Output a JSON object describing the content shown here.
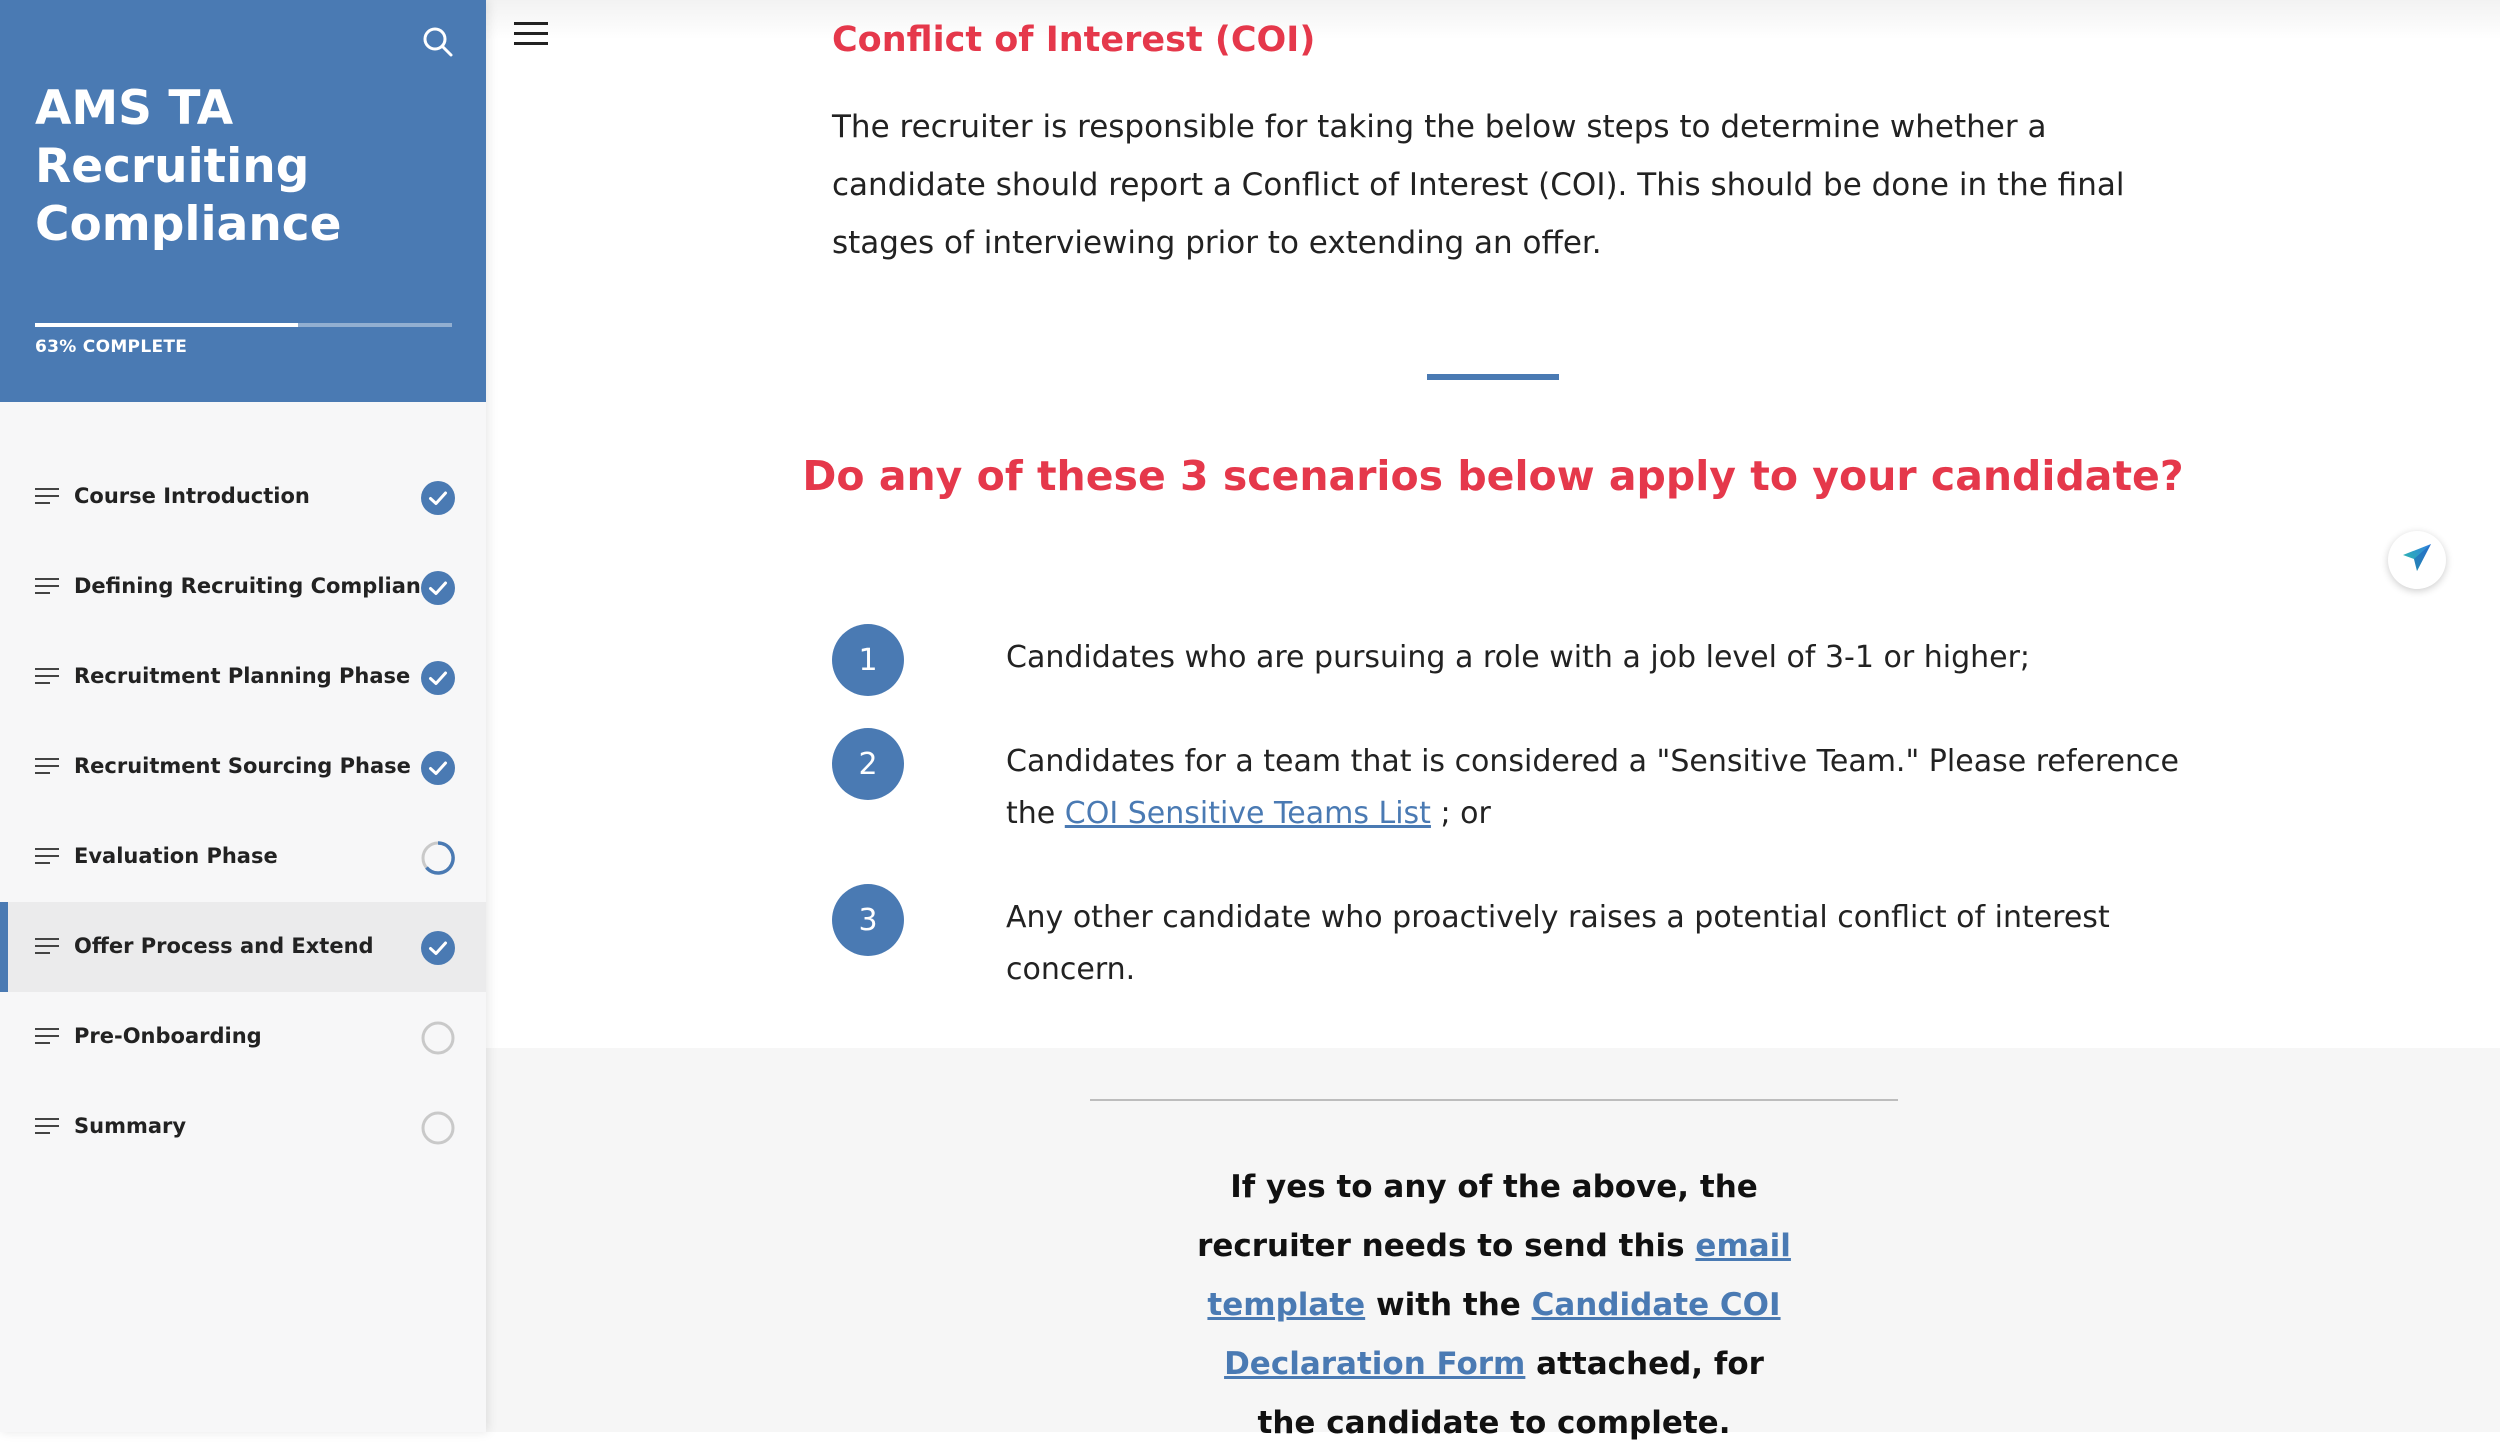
{
  "sidebar": {
    "course_title": "AMS TA Recruiting Compliance",
    "progress": {
      "percent": 63,
      "label": "63% COMPLETE"
    },
    "lessons": [
      {
        "label": "Course Introduction",
        "status": "complete"
      },
      {
        "label": "Defining Recruiting Compliance",
        "status": "complete"
      },
      {
        "label": "Recruitment Planning Phase",
        "status": "complete"
      },
      {
        "label": "Recruitment Sourcing Phase",
        "status": "complete"
      },
      {
        "label": "Evaluation Phase",
        "status": "in-progress"
      },
      {
        "label": "Offer Process and Extend",
        "status": "complete",
        "active": true
      },
      {
        "label": "Pre-Onboarding",
        "status": "not-started"
      },
      {
        "label": "Summary",
        "status": "not-started"
      }
    ]
  },
  "main": {
    "heading": "Conflict of Interest (COI)",
    "intro": "The recruiter is responsible for taking the below steps to determine whether a candidate should report a Conflict of Interest (COI). This should be done in the final stages of interviewing prior to extending an offer.",
    "question": "Do any of these 3 scenarios below apply to your candidate?",
    "scenarios": [
      {
        "number": "1",
        "text": "Candidates who are pursuing a role with a job level of 3-1 or higher;"
      },
      {
        "number": "2",
        "text_before": "Candidates for a team that is considered a \"Sensitive Team.\" Please reference the ",
        "link": "COI Sensitive Teams List",
        "text_after": " ; or"
      },
      {
        "number": "3",
        "text": "Any other candidate who proactively raises a potential conflict of interest concern."
      }
    ],
    "callout": {
      "part1": "If yes to any of the above, the recruiter needs to send this ",
      "link1": "email template",
      "part2": " with the ",
      "link2": "Candidate COI Declaration Form",
      "part3": " attached, for the candidate to complete."
    }
  },
  "colors": {
    "brand_blue": "#4a7ab3",
    "accent_red": "#e5384b"
  },
  "icons": {
    "search": "search-icon",
    "menu": "hamburger-menu-icon",
    "lesson": "lesson-lines-icon",
    "complete": "check-circle-icon",
    "in_progress": "partial-progress-icon",
    "not_started": "empty-circle-icon",
    "send": "paper-plane-icon"
  }
}
